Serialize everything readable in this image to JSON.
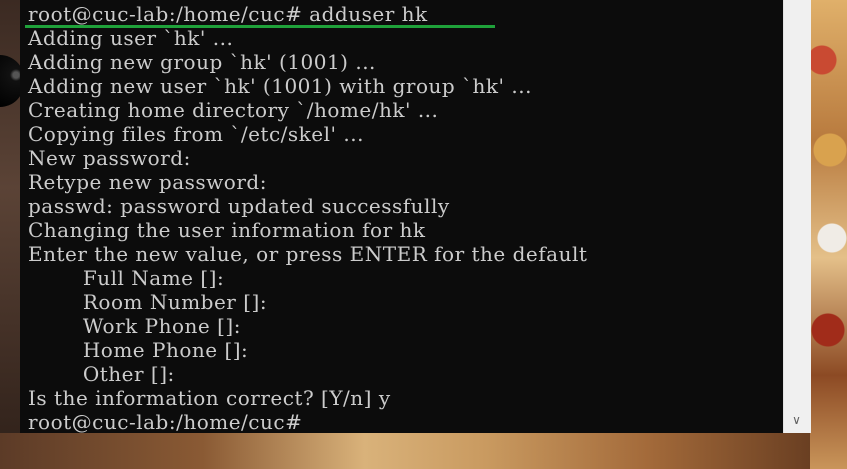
{
  "terminal": {
    "lines": [
      "root@cuc-lab:/home/cuc# adduser hk",
      "Adding user `hk' ...",
      "Adding new group `hk' (1001) ...",
      "Adding new user `hk' (1001) with group `hk' ...",
      "Creating home directory `/home/hk' ...",
      "Copying files from `/etc/skel' ...",
      "New password:",
      "Retype new password:",
      "passwd: password updated successfully",
      "Changing the user information for hk",
      "Enter the new value, or press ENTER for the default",
      "        Full Name []:",
      "        Room Number []:",
      "        Work Phone []:",
      "        Home Phone []:",
      "        Other []:",
      "Is the information correct? [Y/n] y",
      "root@cuc-lab:/home/cuc# "
    ]
  },
  "colors": {
    "terminal_background": "#0c0c0c",
    "terminal_text": "#cccccc",
    "highlight_underline": "#1fa13a",
    "scrollbar": "#f0f0f0"
  },
  "scrollbar": {
    "down_icon": "chevron-down-icon",
    "down_glyph": "∨"
  }
}
